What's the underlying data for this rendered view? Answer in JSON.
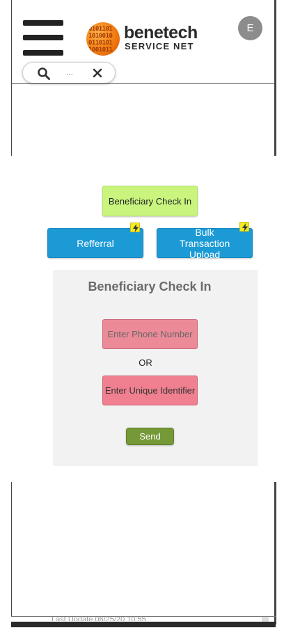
{
  "header": {
    "logo_brand": "benetech",
    "logo_subtitle": "SERVICE NET",
    "avatar_initial": "E"
  },
  "search": {
    "placeholder": "..."
  },
  "actions": {
    "checkin_label": "Beneficiary Check In",
    "referral_label": "Refferral",
    "bulk_label": "Bulk Transaction Upload"
  },
  "checkin_form": {
    "title": "Beneficiary Check In",
    "phone_placeholder": "Enter Phone Number",
    "or_label": "OR",
    "uid_placeholder": "Enter Unique Identifier",
    "send_label": "Send"
  },
  "footer": {
    "last_update": "Last Update 06/25/20 10:55"
  },
  "colors": {
    "checkin_button": "#c9f57f",
    "action_blue": "#1c9ad6",
    "field_pink": "#ee8c9c",
    "send_green": "#759937",
    "lightning_badge": "#f3ea22"
  },
  "icons": {
    "menu": "hamburger-icon",
    "search": "magnifier-icon",
    "clear": "close-icon",
    "badge": "lightning-icon"
  }
}
